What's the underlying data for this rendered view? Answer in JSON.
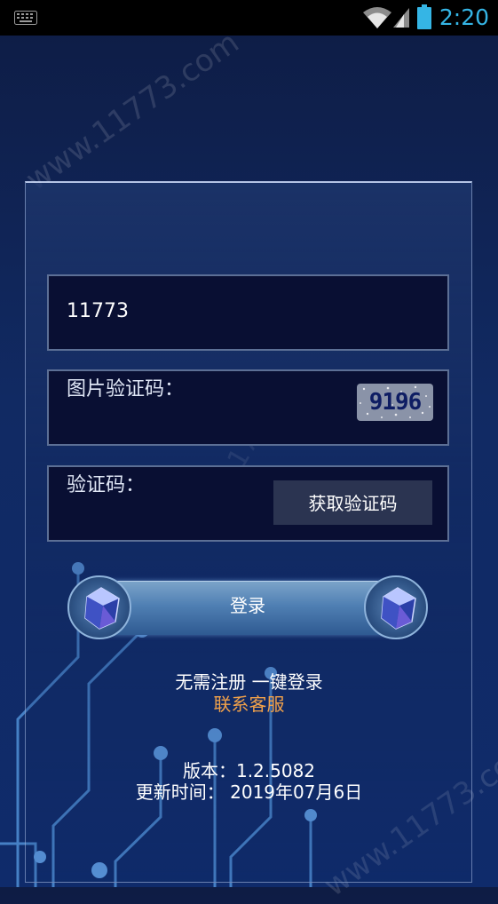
{
  "status_bar": {
    "time": "2:20",
    "time_color": "#35b5e5",
    "icons": [
      "keyboard-icon",
      "wifi-icon",
      "signal-icon",
      "battery-icon"
    ]
  },
  "watermark": {
    "site": "www.11773.com",
    "center": "11773"
  },
  "login_form": {
    "username_value": "11773",
    "captcha_label": "图片验证码：",
    "captcha_code": "9196",
    "verification_label": "验证码：",
    "get_code_button": "获取验证码",
    "login_button": "登录"
  },
  "footer": {
    "tagline": "无需注册 一键登录",
    "contact_link": "联系客服",
    "contact_color": "#f2a24a",
    "version": "版本：1.2.5082",
    "update_time": "更新时间： 2019年07月6日"
  },
  "colors": {
    "background": "#112a63",
    "field_background": "#090f33",
    "button_background": "#2b3451"
  }
}
